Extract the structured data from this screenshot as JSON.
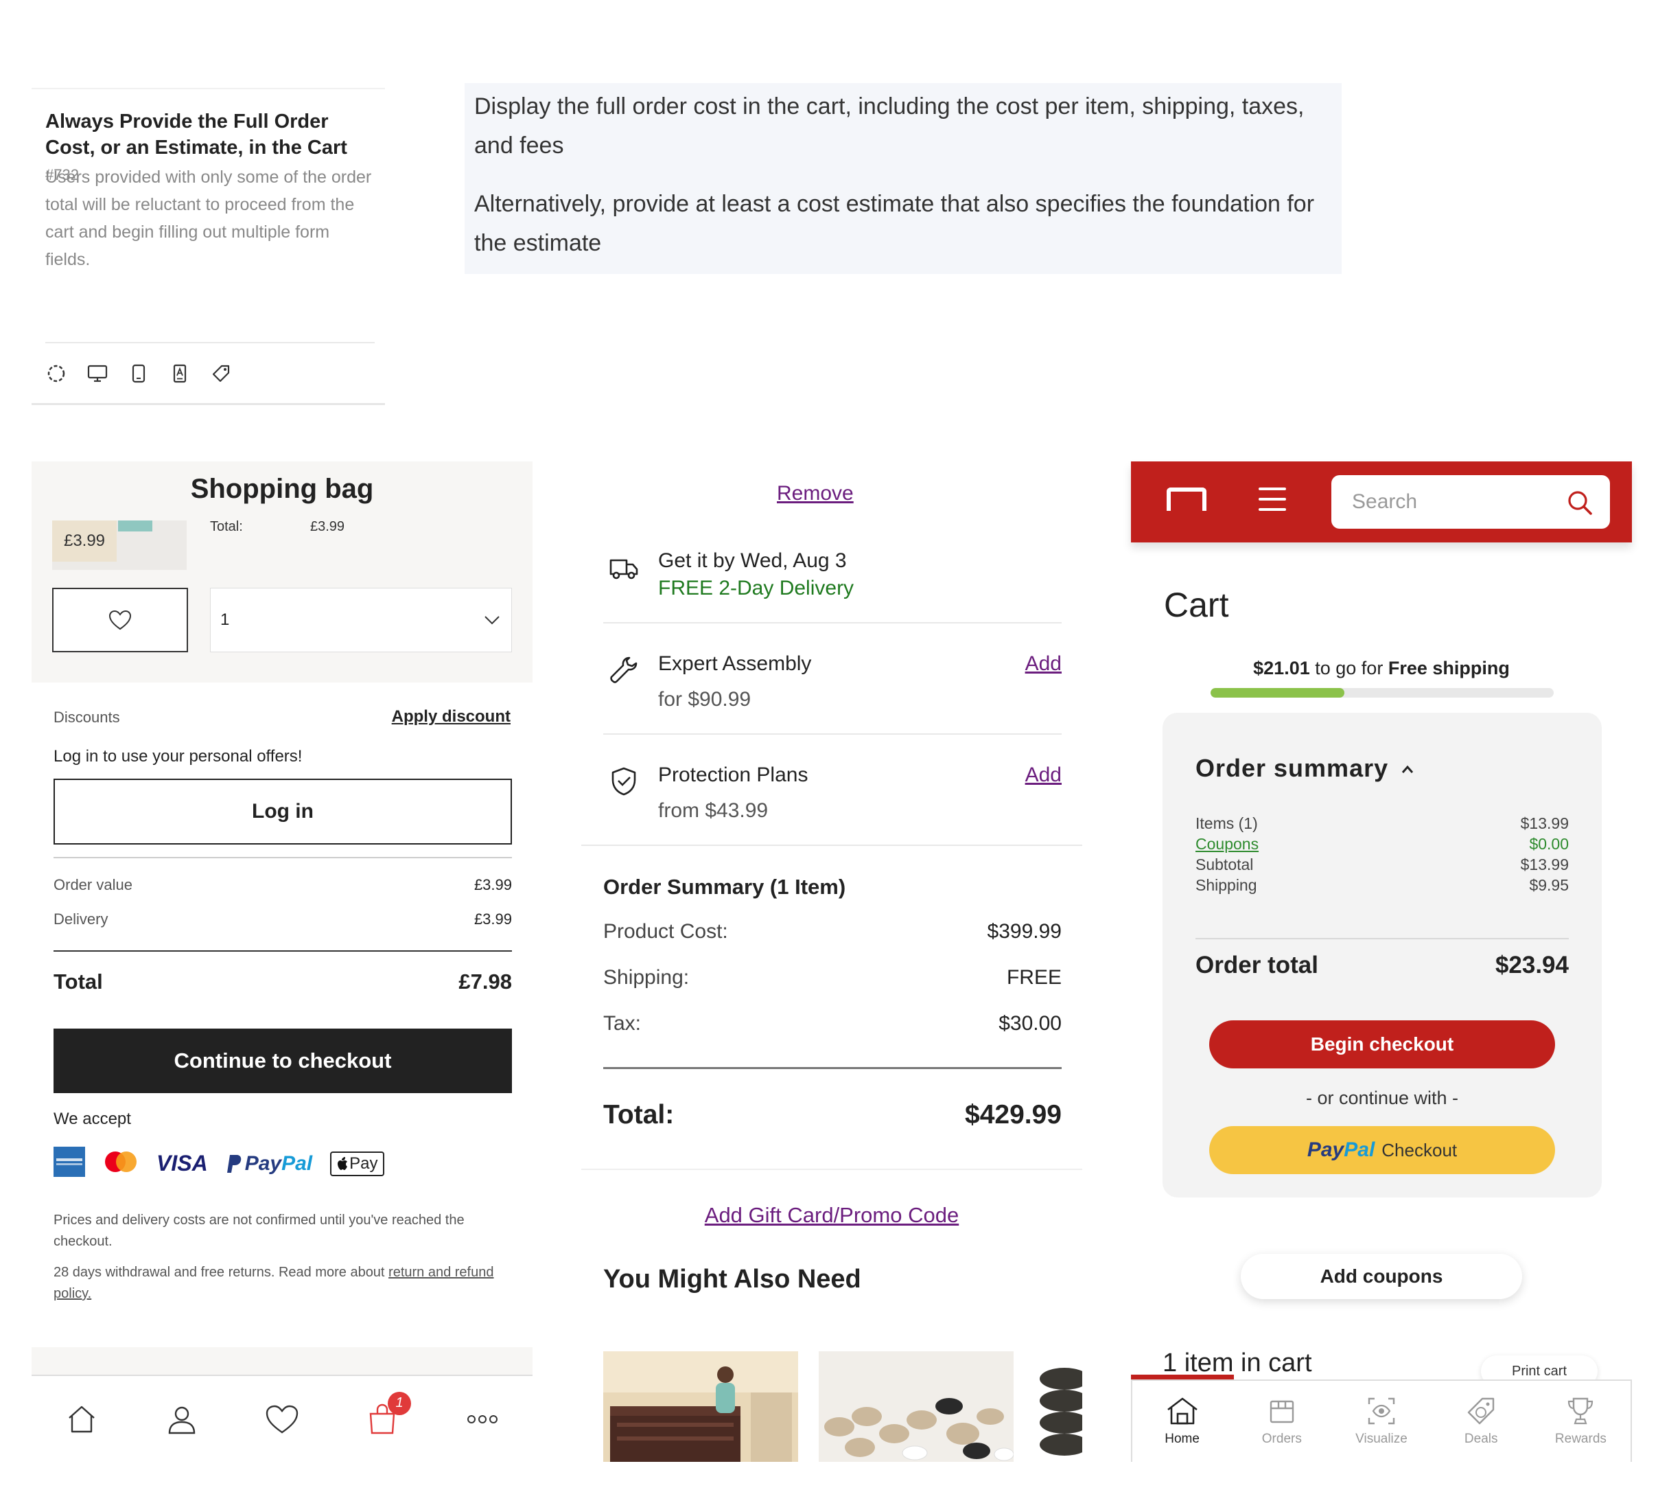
{
  "guideline": {
    "title": "Always Provide the Full Order Cost, or an Estimate, in the Cart",
    "number": "#732",
    "description": "Users provided with only some of the order total will be reluctant to proceed from the cart and begin filling out multiple form fields.",
    "icons": [
      "circle-dashed-icon",
      "desktop-icon",
      "mobile-icon",
      "app-icon",
      "tag-icon"
    ]
  },
  "quote": {
    "p1": "Display the full order cost in the cart, including the cost per item, shipping, taxes, and fees",
    "p2": "Alternatively, provide at least a cost estimate that also specifies the foundation for the estimate"
  },
  "bag": {
    "title": "Shopping bag",
    "item_price": "£3.99",
    "total_label": "Total:",
    "total_value": "£3.99",
    "quantity": "1",
    "discounts_label": "Discounts",
    "apply_discount": "Apply discount",
    "login_prompt": "Log in to use your personal offers!",
    "login_button": "Log in",
    "order_value_label": "Order value",
    "order_value": "£3.99",
    "delivery_label": "Delivery",
    "delivery_value": "£3.99",
    "total_row_label": "Total",
    "total_row_value": "£7.98",
    "checkout_button": "Continue to checkout",
    "we_accept": "We accept",
    "payment_logos": {
      "visa": "VISA",
      "paypal_a": "Pay",
      "paypal_b": "Pal",
      "applepay": "Pay"
    },
    "note1": "Prices and delivery costs are not confirmed until you've reached the checkout.",
    "note2_text": "28 days withdrawal and free returns. Read more about ",
    "note2_link": "return and refund policy.",
    "cart_badge": "1"
  },
  "mid": {
    "remove": "Remove",
    "delivery_line1": "Get it by Wed, Aug 3",
    "delivery_line2": "FREE 2-Day Delivery",
    "assembly_title": "Expert Assembly",
    "assembly_price": "for $90.99",
    "assembly_add": "Add",
    "protection_title": "Protection Plans",
    "protection_price": "from $43.99",
    "protection_add": "Add",
    "summary_title": "Order Summary (1 Item)",
    "rows": [
      {
        "label": "Product Cost:",
        "value": "$399.99"
      },
      {
        "label": "Shipping:",
        "value": "FREE"
      },
      {
        "label": "Tax:",
        "value": "$30.00"
      }
    ],
    "total_label": "Total:",
    "total_value": "$429.99",
    "promo_link": "Add Gift Card/Promo Code",
    "also_need": "You Might Also Need"
  },
  "cart": {
    "search_placeholder": "Search",
    "title": "Cart",
    "ship_amount": "$21.01",
    "ship_to_go": "to go for",
    "ship_free": "Free shipping",
    "ship_progress": 0.39,
    "summary_title": "Order summary",
    "rows": [
      {
        "label": "Items (1)",
        "value": "$13.99"
      },
      {
        "label": "Coupons",
        "value": "$0.00"
      },
      {
        "label": "Subtotal",
        "value": "$13.99"
      },
      {
        "label": "Shipping",
        "value": "$9.95"
      }
    ],
    "order_total_label": "Order total",
    "order_total_value": "$23.94",
    "begin_checkout": "Begin checkout",
    "or_continue": "- or continue with -",
    "paypal_a": "Pay",
    "paypal_b": "Pal",
    "paypal_checkout": "Checkout",
    "add_coupons": "Add coupons",
    "items_in_cart": "1 item in cart",
    "print_cart": "Print cart",
    "nav": [
      "Home",
      "Orders",
      "Visualize",
      "Deals",
      "Rewards"
    ],
    "brand_red": "#c0201c"
  }
}
